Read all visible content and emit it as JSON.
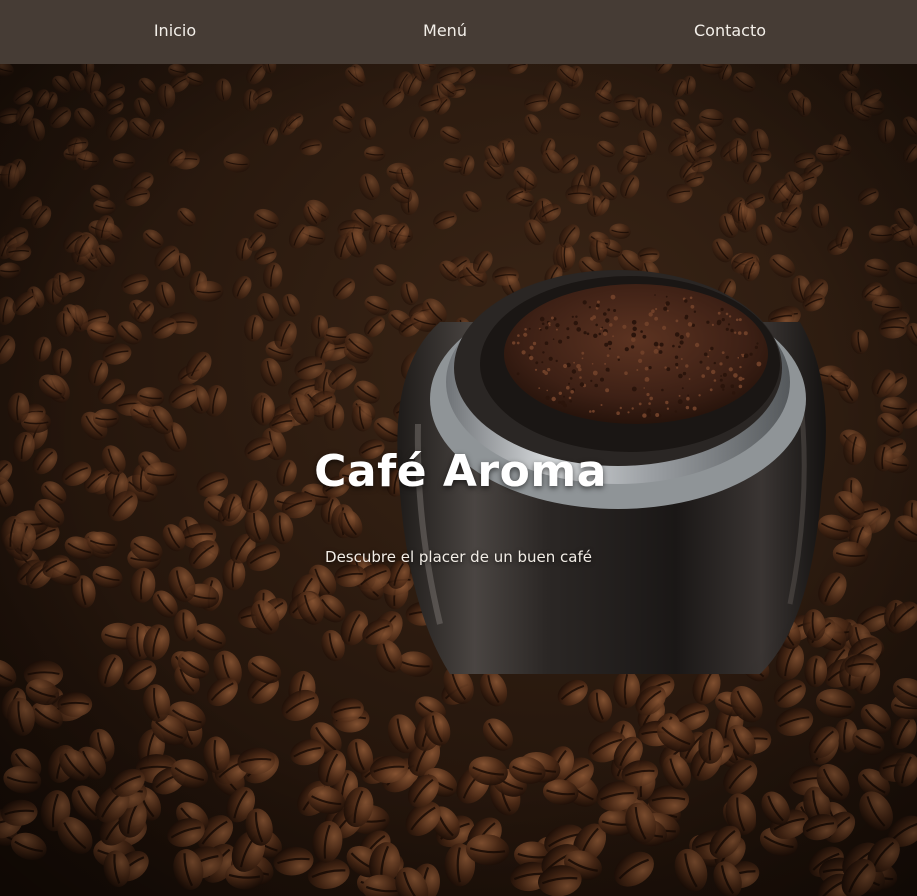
{
  "nav": {
    "home_label": "Inicio",
    "menu_label": "Menú",
    "contact_label": "Contacto",
    "background_color": "#463c35"
  },
  "hero": {
    "title": "Café Aroma",
    "subtitle": "Descubre el placer de un buen café",
    "image": "coffee-beans-with-ground-coffee-jar"
  }
}
